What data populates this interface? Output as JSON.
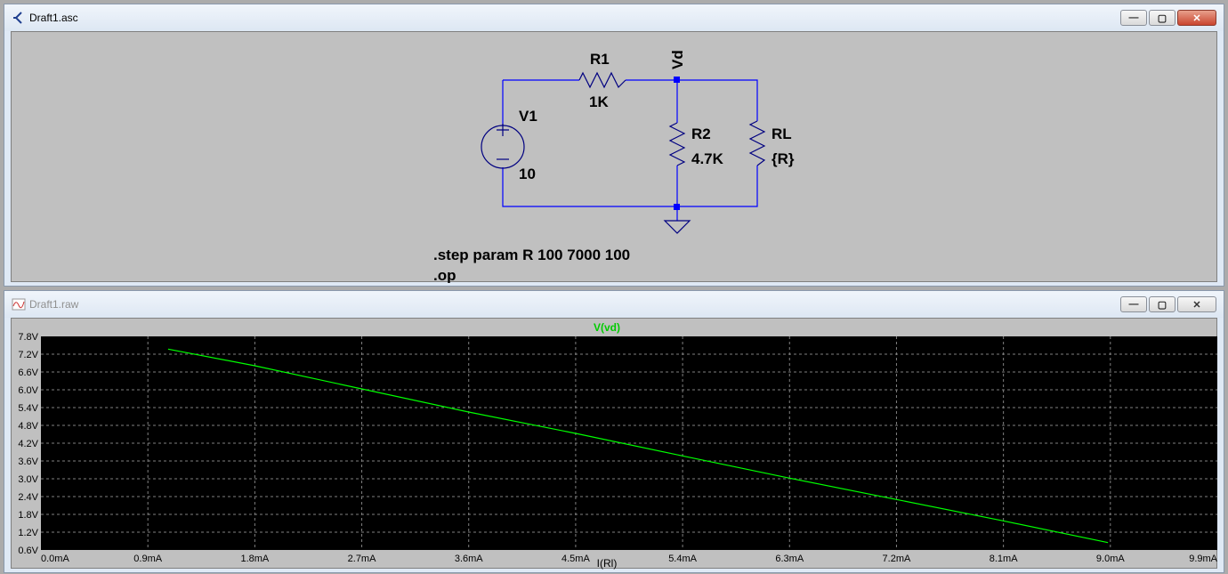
{
  "schematic_window": {
    "title": "Draft1.asc",
    "icon": "ltspice-schematic-icon",
    "buttons": {
      "minimize": "—",
      "maximize": "▢",
      "close": "✕"
    },
    "components": {
      "r1_name": "R1",
      "r1_value": "1K",
      "r2_name": "R2",
      "r2_value": "4.7K",
      "rl_name": "RL",
      "rl_value": "{R}",
      "v1_name": "V1",
      "v1_value": "10",
      "net_label": "Vd"
    },
    "directives": [
      ".step param R 100 7000 100",
      ".op"
    ],
    "colors": {
      "wire": "#0000ff",
      "component": "#000080",
      "background": "#c0c0c0"
    }
  },
  "plot_window": {
    "title": "Draft1.raw",
    "icon": "waveform-viewer-icon",
    "buttons": {
      "minimize": "—",
      "maximize": "▢",
      "close": "✕"
    }
  },
  "chart_data": {
    "type": "line",
    "title": "V(vd)",
    "xlabel": "I(Rl)",
    "ylabel": "",
    "x_unit": "mA",
    "y_unit": "V",
    "xlim": [
      0,
      9.9
    ],
    "ylim": [
      0.6,
      7.8
    ],
    "x_ticks": [
      "0.0mA",
      "0.9mA",
      "1.8mA",
      "2.7mA",
      "3.6mA",
      "4.5mA",
      "5.4mA",
      "6.3mA",
      "7.2mA",
      "8.1mA",
      "9.0mA",
      "9.9mA"
    ],
    "y_ticks": [
      "7.8V",
      "7.2V",
      "6.6V",
      "6.0V",
      "5.4V",
      "4.8V",
      "4.2V",
      "3.6V",
      "3.0V",
      "2.4V",
      "1.8V",
      "1.2V",
      "0.6V"
    ],
    "grid": true,
    "series": [
      {
        "name": "V(vd)",
        "color": "#00ff00",
        "x": [
          1.07,
          1.8,
          2.7,
          3.6,
          4.5,
          5.4,
          6.3,
          7.2,
          8.1,
          8.98
        ],
        "y": [
          7.37,
          6.81,
          6.03,
          5.25,
          4.53,
          3.77,
          3.02,
          2.3,
          1.58,
          0.85
        ]
      }
    ],
    "background": "#000000",
    "grid_color": "#808080",
    "axis_text_color": "#000000",
    "title_color": "#00ff00"
  }
}
